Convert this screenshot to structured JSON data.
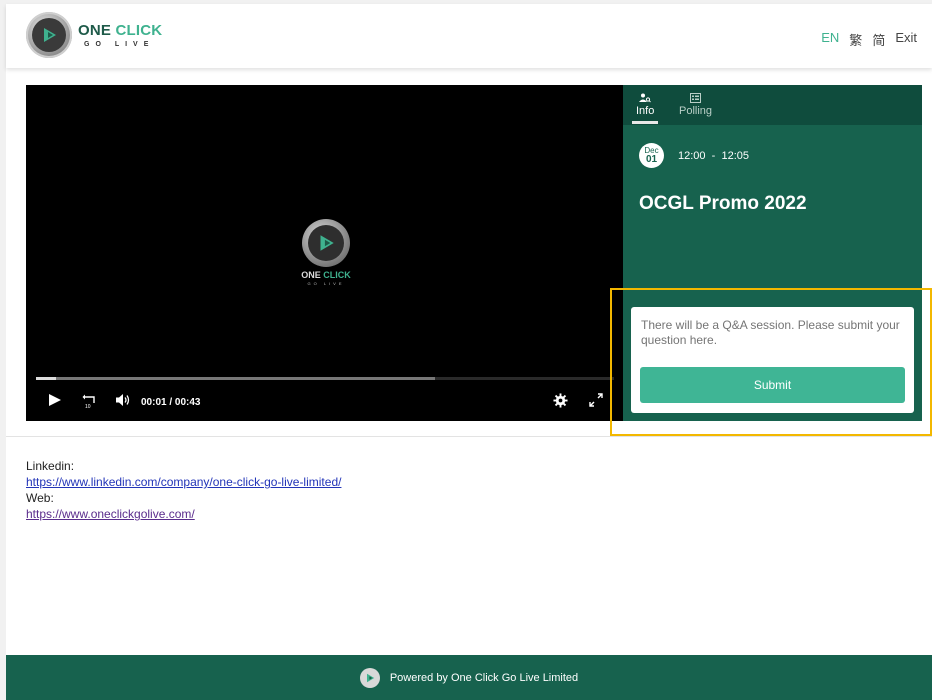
{
  "header": {
    "logo": {
      "title_main": "ONE",
      "title_accent": "CLICK",
      "subtitle": "GO LIVE"
    },
    "lang": {
      "en": "EN",
      "traditional": "繁",
      "simplified": "简",
      "exit": "Exit"
    }
  },
  "video": {
    "logo": {
      "title_main": "ONE",
      "title_accent": "CLICK",
      "subtitle": "GO LIVE"
    },
    "current_time": "00:01",
    "separator": "/",
    "duration": "00:43",
    "rewind_label": "10",
    "played_fraction": 0.035,
    "buffered_fraction": 0.69
  },
  "panel": {
    "tabs": [
      {
        "label": "Info",
        "icon": "person-search-icon",
        "active": true
      },
      {
        "label": "Polling",
        "icon": "polling-icon",
        "active": false
      }
    ],
    "date": {
      "month": "Dec",
      "day": "01"
    },
    "time_start": "12:00",
    "time_dash": "-",
    "time_end": "12:05",
    "title": "OCGL Promo 2022",
    "qa": {
      "text": "There will be a Q&A session. Please submit your question here.",
      "submit_label": "Submit"
    }
  },
  "links": {
    "linkedin_label": "Linkedin:",
    "linkedin_url": "https://www.linkedin.com/company/one-click-go-live-limited/",
    "web_label": "Web:",
    "web_url": "https://www.oneclickgolive.com/"
  },
  "footer": {
    "text": "Powered by One Click Go Live Limited"
  },
  "colors": {
    "brand_dark": "#17624e",
    "brand_accent": "#3fb595",
    "highlight": "#f3b800"
  }
}
